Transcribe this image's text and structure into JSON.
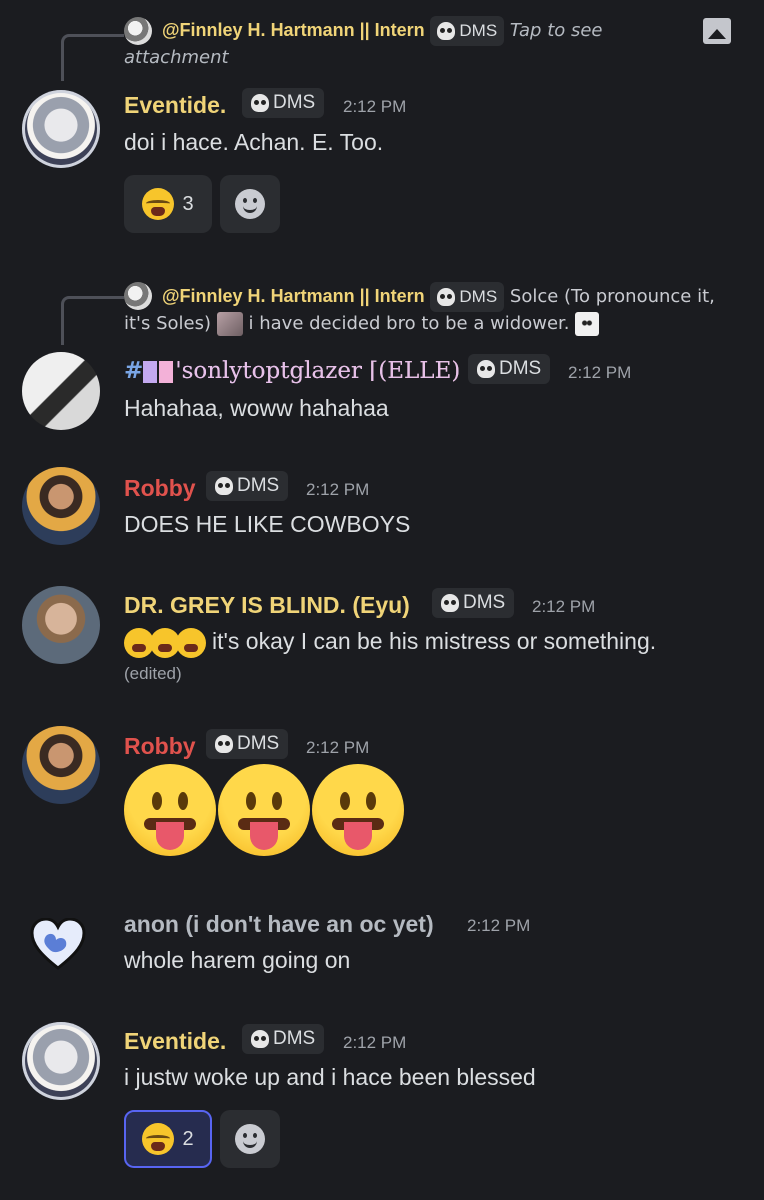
{
  "messages": [
    {
      "reply": {
        "name": "@Finnley H. Hartmann || Intern",
        "tag": "DMS",
        "text": "Tap to see",
        "text2": "attachment"
      },
      "author": "Eventide.",
      "author_color": "#f0d478",
      "tag": "DMS",
      "time": "2:12 PM",
      "content": "doi i hace. Achan. E. Too.",
      "reaction": {
        "count": "3"
      }
    },
    {
      "reply": {
        "name": "@Finnley H. Hartmann || Intern",
        "tag": "DMS",
        "text": "Solce (To pronounce it,",
        "text2a": "it's Soles)",
        "text2b": "i have decided bro to be a widower."
      },
      "author": "'sonlytoptglazer ⌈(ELLE)",
      "author_prefix": "#",
      "tag": "DMS",
      "time": "2:12 PM",
      "content": "Hahahaa, woww hahahaa"
    },
    {
      "author": "Robby",
      "author_color": "#e0524d",
      "tag": "DMS",
      "time": "2:12 PM",
      "content": "DOES HE LIKE COWBOYS"
    },
    {
      "author": "DR. GREY IS BLIND. (Eyu)",
      "author_color": "#f0d478",
      "tag": "DMS",
      "time": "2:12 PM",
      "content": "it's okay I can be his mistress or something.",
      "edited": "(edited)"
    },
    {
      "author": "Robby",
      "author_color": "#e0524d",
      "tag": "DMS",
      "time": "2:12 PM"
    },
    {
      "author": "anon (i don't have an oc yet)",
      "author_color": "#b5bac1",
      "time": "2:12 PM",
      "content": "whole harem going on"
    },
    {
      "author": "Eventide.",
      "author_color": "#f0d478",
      "tag": "DMS",
      "time": "2:12 PM",
      "content": "i justw woke up and i hace been blessed",
      "reaction": {
        "count": "2"
      }
    }
  ],
  "icons": {
    "attachment": "image-icon",
    "tag": "skull-icon",
    "reaction": "loudly-crying-emoji",
    "add_reaction": "add-reaction-smile-icon",
    "big_emoji": "face-with-tongue-emoji"
  }
}
